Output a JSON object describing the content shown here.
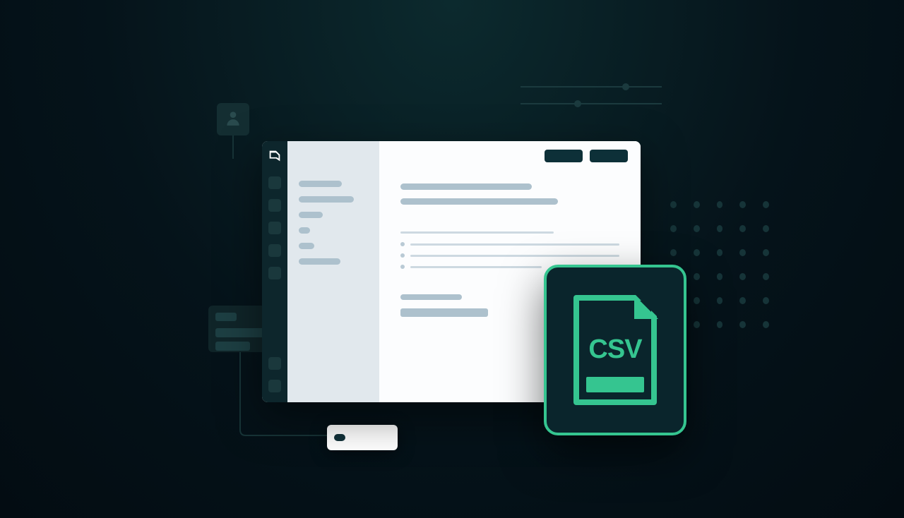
{
  "csv_label": "CSV",
  "colors": {
    "accent": "#35c590",
    "dark_panel": "#0a252c",
    "skeleton": "#adc1cd",
    "skeleton_light": "#cdd9e1"
  },
  "sliders": [
    {
      "thumb_position_pct": 72
    },
    {
      "thumb_position_pct": 38
    }
  ],
  "sidebar_item_widths_pct": [
    62,
    80,
    35,
    16,
    22,
    60
  ],
  "content": {
    "heading_width_pct": 60,
    "subheading_width_pct": 72,
    "radio_divider_width_pct": 70,
    "radio_count": 3,
    "action_label_width_pct": 28,
    "action_button_width_pct": 40
  },
  "dot_grid": {
    "rows": 6,
    "cols": 5
  },
  "rail_icon_count": 7
}
